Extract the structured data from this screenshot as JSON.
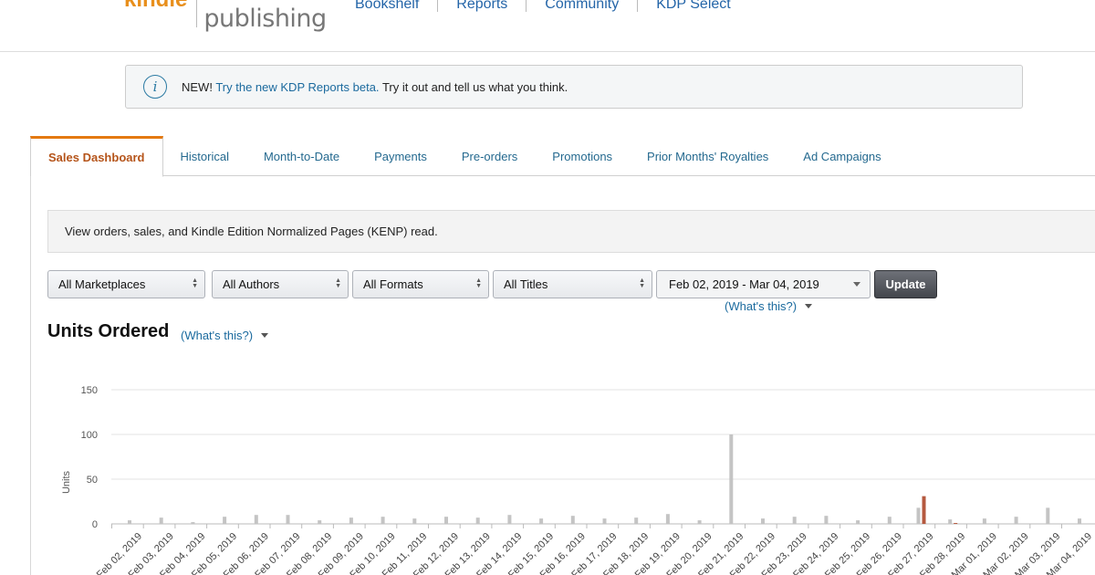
{
  "header": {
    "logo_kindle": "kindle",
    "logo_publishing": "publishing",
    "nav": [
      "Bookshelf",
      "Reports",
      "Community",
      "KDP Select"
    ]
  },
  "banner": {
    "prefix": "NEW!",
    "link": "Try the new KDP Reports beta.",
    "suffix": "Try it out and tell us what you think."
  },
  "tabs": [
    "Sales Dashboard",
    "Historical",
    "Month-to-Date",
    "Payments",
    "Pre-orders",
    "Promotions",
    "Prior Months' Royalties",
    "Ad Campaigns"
  ],
  "active_tab": "Sales Dashboard",
  "description": "View orders, sales, and Kindle Edition Normalized Pages (KENP) read.",
  "filters": {
    "marketplace": "All Marketplaces",
    "authors": "All Authors",
    "formats": "All Formats",
    "titles": "All Titles",
    "date_range": "Feb 02, 2019 - Mar 04, 2019",
    "update_label": "Update",
    "whats_this": "(What's this?)"
  },
  "chart_section": {
    "title": "Units Ordered",
    "whats_this": "(What's this?)"
  },
  "colors": {
    "accent": "#e47911",
    "link": "#1b6a9e",
    "bar_gray": "#c4c4c4",
    "bar_highlight": "#b5593f"
  },
  "chart_data": {
    "type": "bar",
    "ylabel": "Units",
    "ylim": [
      0,
      150
    ],
    "yticks": [
      0,
      50,
      100,
      150
    ],
    "categories": [
      "Feb 02, 2019",
      "Feb 03, 2019",
      "Feb 04, 2019",
      "Feb 05, 2019",
      "Feb 06, 2019",
      "Feb 07, 2019",
      "Feb 08, 2019",
      "Feb 09, 2019",
      "Feb 10, 2019",
      "Feb 11, 2019",
      "Feb 12, 2019",
      "Feb 13, 2019",
      "Feb 14, 2019",
      "Feb 15, 2019",
      "Feb 16, 2019",
      "Feb 17, 2019",
      "Feb 18, 2019",
      "Feb 19, 2019",
      "Feb 20, 2019",
      "Feb 21, 2019",
      "Feb 22, 2019",
      "Feb 23, 2019",
      "Feb 24, 2019",
      "Feb 25, 2019",
      "Feb 26, 2019",
      "Feb 27, 2019",
      "Feb 28, 2019",
      "Mar 01, 2019",
      "Mar 02, 2019",
      "Mar 03, 2019",
      "Mar 04, 2019"
    ],
    "series": [
      {
        "values": [
          4,
          7,
          2,
          8,
          10,
          10,
          4,
          7,
          8,
          6,
          8,
          7,
          10,
          6,
          9,
          6,
          7,
          11,
          4,
          100,
          6,
          8,
          9,
          4,
          8,
          18,
          5,
          6,
          8,
          18,
          6
        ],
        "color": "#c4c4c4"
      },
      {
        "values": [
          0,
          0,
          0,
          0,
          0,
          0,
          0,
          0,
          0,
          0,
          0,
          0,
          0,
          0,
          0,
          0,
          0,
          0,
          0,
          0,
          0,
          0,
          0,
          0,
          0,
          31,
          1,
          0,
          0,
          0,
          0
        ],
        "color": "#b5593f"
      }
    ]
  }
}
